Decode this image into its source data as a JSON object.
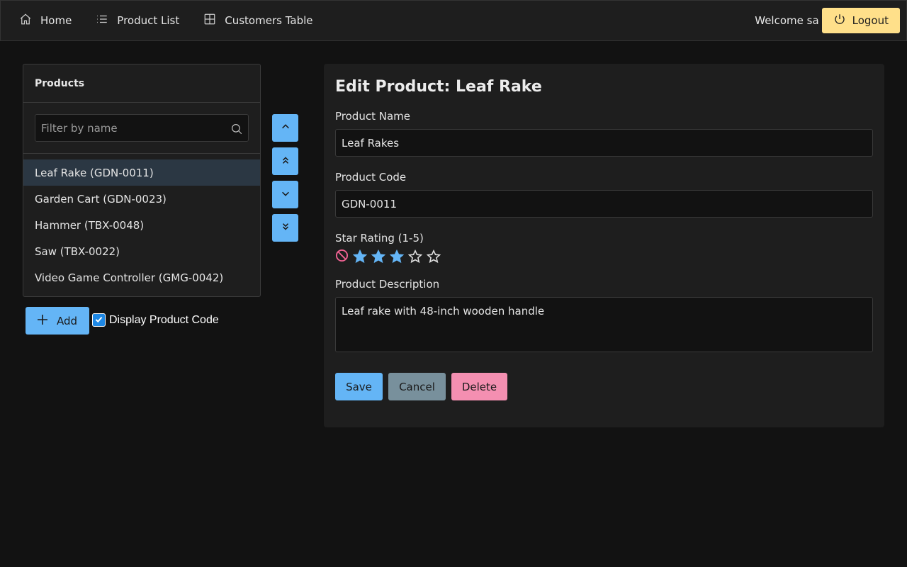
{
  "nav": {
    "home": "Home",
    "product_list": "Product List",
    "customers_table": "Customers Table"
  },
  "user": {
    "welcome": "Welcome sa",
    "logout": "Logout"
  },
  "products_panel": {
    "header": "Products",
    "filter_placeholder": "Filter by name",
    "items": [
      {
        "label": "Leaf Rake (GDN-0011)",
        "selected": true
      },
      {
        "label": "Garden Cart (GDN-0023)",
        "selected": false
      },
      {
        "label": "Hammer (TBX-0048)",
        "selected": false
      },
      {
        "label": "Saw (TBX-0022)",
        "selected": false
      },
      {
        "label": "Video Game Controller (GMG-0042)",
        "selected": false
      }
    ],
    "add_label": "Add",
    "display_code_label": "Display Product Code",
    "display_code_checked": true
  },
  "edit": {
    "title": "Edit Product: Leaf Rake",
    "name_label": "Product Name",
    "name_value": "Leaf Rakes",
    "code_label": "Product Code",
    "code_value": "GDN-0011",
    "rating_label": "Star Rating (1-5)",
    "rating_value": 3,
    "rating_max": 5,
    "description_label": "Product Description",
    "description_value": "Leaf rake with 48-inch wooden handle",
    "save": "Save",
    "cancel": "Cancel",
    "delete": "Delete"
  },
  "colors": {
    "primary": "#64b5f6",
    "warning": "#ffe08a",
    "secondary": "#78909c",
    "danger": "#f48fb1",
    "selected_row": "#2b3743"
  }
}
